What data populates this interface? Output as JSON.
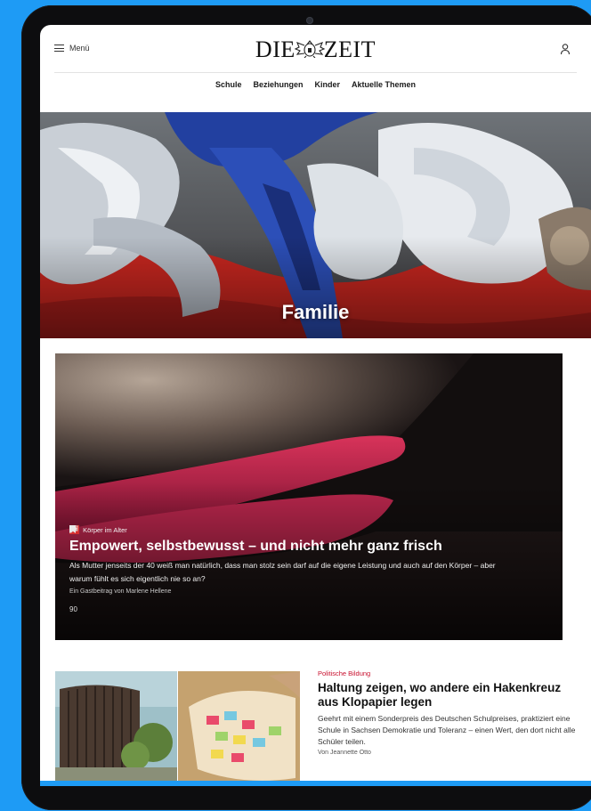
{
  "header": {
    "menu_label": "Menü",
    "logo_left": "DIE",
    "logo_right": "ZEIT"
  },
  "subnav": [
    "Schule",
    "Beziehungen",
    "Kinder",
    "Aktuelle Themen"
  ],
  "hero": {
    "title": "Familie"
  },
  "teaser": {
    "badge": "Z+",
    "kicker": "Körper im Alter",
    "headline": "Empowert, selbstbewusst – und nicht mehr ganz frisch",
    "summary": "Als Mutter jenseits der 40 weiß man natürlich, dass man stolz sein darf auf die eigene Leistung und auch auf den Körper – aber warum fühlt es sich eigentlich nie so an?",
    "author": "Ein Gastbeitrag von Marlene Hellene",
    "comment_count": "90"
  },
  "article2": {
    "kicker": "Politische Bildung",
    "headline": "Haltung zeigen, wo andere ein Hakenkreuz aus Klopapier legen",
    "summary": "Geehrt mit einem Sonderpreis des Deutschen Schulpreises, praktiziert eine Schule in Sachsen Demokratie und Toleranz – einen Wert, den dort nicht alle Schüler teilen.",
    "author": "Von Jeannette Otto"
  },
  "colors": {
    "background": "#1e9bf5",
    "kicker_red": "#c8102e",
    "zplus_red": "#d62d2d"
  },
  "icons": [
    "hamburger-icon",
    "crest-icon",
    "user-icon",
    "comment-icon",
    "bookmark-icon"
  ]
}
